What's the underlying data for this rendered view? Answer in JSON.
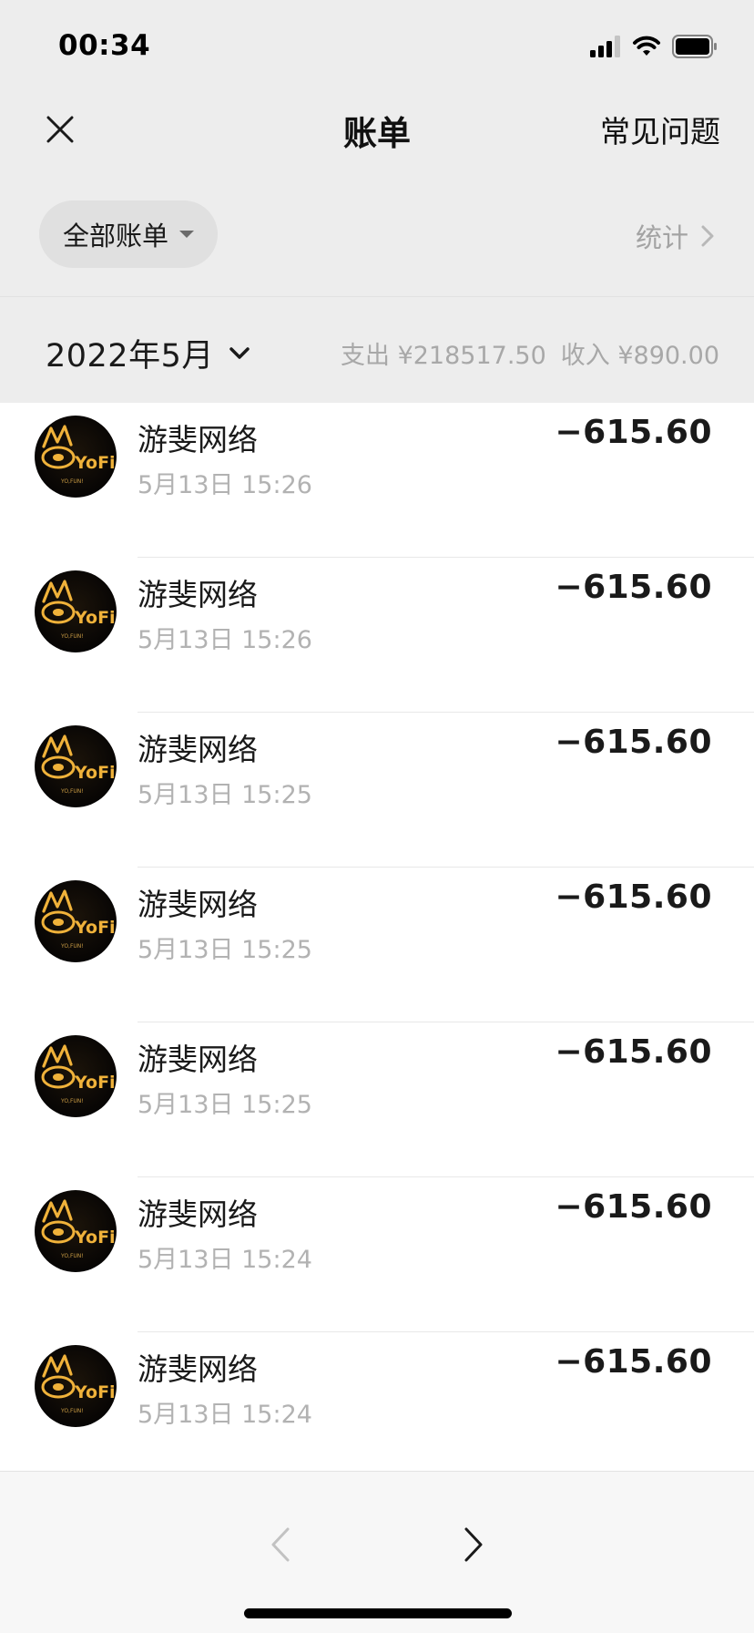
{
  "status_bar": {
    "time": "00:34"
  },
  "nav": {
    "title": "账单",
    "faq_label": "常见问题"
  },
  "filter": {
    "label": "全部账单",
    "stats_label": "统计"
  },
  "month": {
    "label": "2022年5月",
    "expense": "支出 ¥218517.50",
    "income": "收入 ¥890.00"
  },
  "transactions": [
    {
      "name": "游斐网络",
      "time": "5月13日 15:26",
      "amount": "−615.60"
    },
    {
      "name": "游斐网络",
      "time": "5月13日 15:26",
      "amount": "−615.60"
    },
    {
      "name": "游斐网络",
      "time": "5月13日 15:25",
      "amount": "−615.60"
    },
    {
      "name": "游斐网络",
      "time": "5月13日 15:25",
      "amount": "−615.60"
    },
    {
      "name": "游斐网络",
      "time": "5月13日 15:25",
      "amount": "−615.60"
    },
    {
      "name": "游斐网络",
      "time": "5月13日 15:24",
      "amount": "−615.60"
    },
    {
      "name": "游斐网络",
      "time": "5月13日 15:24",
      "amount": "−615.60"
    }
  ],
  "avatar": {
    "logo_text": "YoFi",
    "tagline": "YO,FUN!"
  },
  "icons": {
    "close": "close-icon",
    "caret": "caret-down-icon",
    "stats_chevron": "chevron-right-icon",
    "month_chevron": "chevron-down-icon",
    "back": "back-arrow-icon",
    "forward": "forward-arrow-icon",
    "signal": "signal-icon",
    "wifi": "wifi-icon",
    "battery": "battery-icon"
  },
  "colors": {
    "header_bg": "#ededed",
    "secondary_text": "#a8a8a8",
    "logo_gold": "#f0b23a"
  }
}
